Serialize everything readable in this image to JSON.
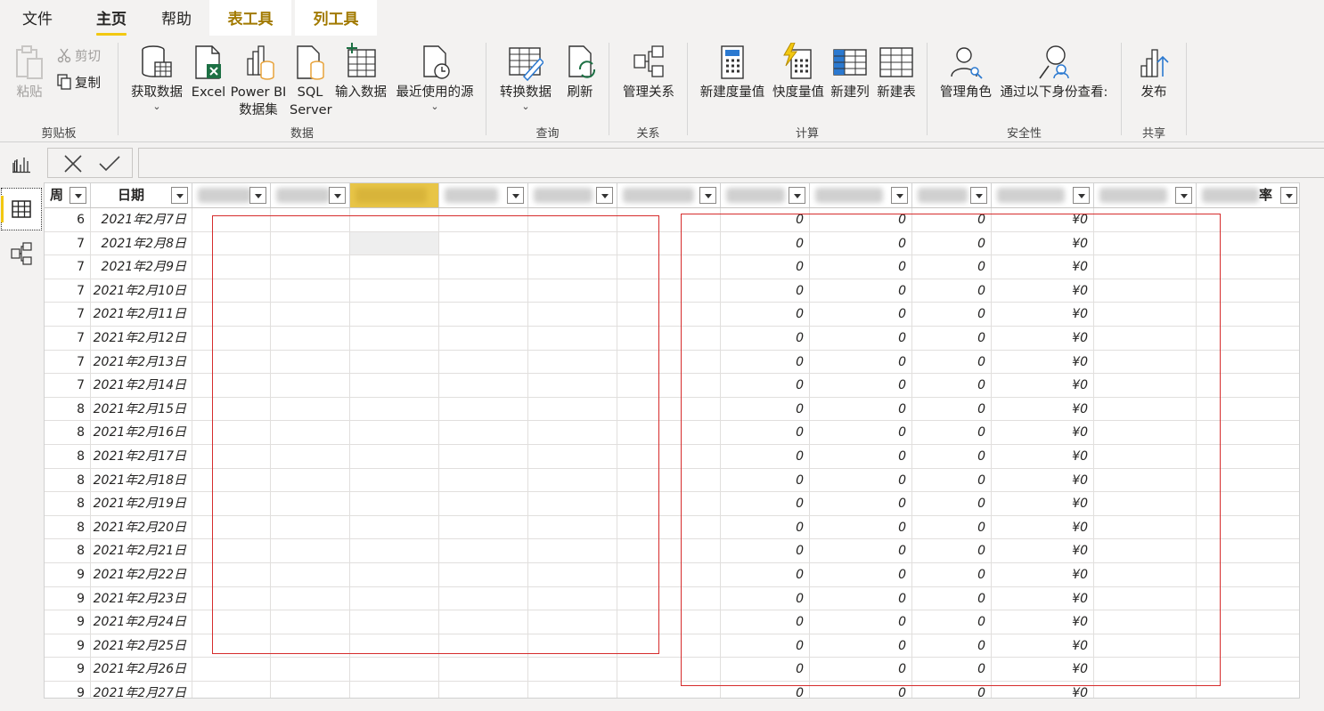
{
  "tabs": {
    "file": "文件",
    "home": "主页",
    "help": "帮助",
    "table_tools": "表工具",
    "column_tools": "列工具"
  },
  "ribbon": {
    "clipboard": {
      "label": "剪贴板",
      "paste": "粘贴",
      "cut": "剪切",
      "copy": "复制"
    },
    "data": {
      "label": "数据",
      "get_data": "获取数据",
      "excel": "Excel",
      "powerbi_line1": "Power BI",
      "powerbi_line2": "数据集",
      "sql_line1": "SQL",
      "sql_line2": "Server",
      "enter_data": "输入数据",
      "recent_sources": "最近使用的源"
    },
    "query": {
      "label": "查询",
      "transform": "转换数据",
      "refresh": "刷新"
    },
    "relationships": {
      "label": "关系",
      "manage": "管理关系"
    },
    "calculations": {
      "label": "计算",
      "new_measure": "新建度量值",
      "quick_measure": "快度量值",
      "new_column": "新建列",
      "new_table": "新建表"
    },
    "security": {
      "label": "安全性",
      "manage_roles": "管理角色",
      "view_as": "通过以下身份查看:"
    },
    "share": {
      "label": "共享",
      "publish": "发布"
    }
  },
  "icons": {
    "report_view": "bar-chart-icon",
    "data_view": "table-grid-icon",
    "model_view": "model-diagram-icon",
    "cancel": "close-x-icon",
    "commit": "checkmark-icon"
  },
  "colors": {
    "accent": "#f2c811",
    "context_tab_text": "#a27a00",
    "highlight_column": "#e8c547",
    "red_box": "#d62c2c"
  },
  "grid": {
    "headers": {
      "week": "周",
      "date": "日期",
      "last": "率"
    },
    "rows": [
      {
        "week": "6",
        "date": "2021年2月7日",
        "v1": "0",
        "v2": "0",
        "v3": "0",
        "amount": "¥0"
      },
      {
        "week": "7",
        "date": "2021年2月8日",
        "v1": "0",
        "v2": "0",
        "v3": "0",
        "amount": "¥0"
      },
      {
        "week": "7",
        "date": "2021年2月9日",
        "v1": "0",
        "v2": "0",
        "v3": "0",
        "amount": "¥0"
      },
      {
        "week": "7",
        "date": "2021年2月10日",
        "v1": "0",
        "v2": "0",
        "v3": "0",
        "amount": "¥0"
      },
      {
        "week": "7",
        "date": "2021年2月11日",
        "v1": "0",
        "v2": "0",
        "v3": "0",
        "amount": "¥0"
      },
      {
        "week": "7",
        "date": "2021年2月12日",
        "v1": "0",
        "v2": "0",
        "v3": "0",
        "amount": "¥0"
      },
      {
        "week": "7",
        "date": "2021年2月13日",
        "v1": "0",
        "v2": "0",
        "v3": "0",
        "amount": "¥0"
      },
      {
        "week": "7",
        "date": "2021年2月14日",
        "v1": "0",
        "v2": "0",
        "v3": "0",
        "amount": "¥0"
      },
      {
        "week": "8",
        "date": "2021年2月15日",
        "v1": "0",
        "v2": "0",
        "v3": "0",
        "amount": "¥0"
      },
      {
        "week": "8",
        "date": "2021年2月16日",
        "v1": "0",
        "v2": "0",
        "v3": "0",
        "amount": "¥0"
      },
      {
        "week": "8",
        "date": "2021年2月17日",
        "v1": "0",
        "v2": "0",
        "v3": "0",
        "amount": "¥0"
      },
      {
        "week": "8",
        "date": "2021年2月18日",
        "v1": "0",
        "v2": "0",
        "v3": "0",
        "amount": "¥0"
      },
      {
        "week": "8",
        "date": "2021年2月19日",
        "v1": "0",
        "v2": "0",
        "v3": "0",
        "amount": "¥0"
      },
      {
        "week": "8",
        "date": "2021年2月20日",
        "v1": "0",
        "v2": "0",
        "v3": "0",
        "amount": "¥0"
      },
      {
        "week": "8",
        "date": "2021年2月21日",
        "v1": "0",
        "v2": "0",
        "v3": "0",
        "amount": "¥0"
      },
      {
        "week": "9",
        "date": "2021年2月22日",
        "v1": "0",
        "v2": "0",
        "v3": "0",
        "amount": "¥0"
      },
      {
        "week": "9",
        "date": "2021年2月23日",
        "v1": "0",
        "v2": "0",
        "v3": "0",
        "amount": "¥0"
      },
      {
        "week": "9",
        "date": "2021年2月24日",
        "v1": "0",
        "v2": "0",
        "v3": "0",
        "amount": "¥0"
      },
      {
        "week": "9",
        "date": "2021年2月25日",
        "v1": "0",
        "v2": "0",
        "v3": "0",
        "amount": "¥0"
      },
      {
        "week": "9",
        "date": "2021年2月26日",
        "v1": "0",
        "v2": "0",
        "v3": "0",
        "amount": "¥0"
      },
      {
        "week": "9",
        "date": "2021年2月27日",
        "v1": "0",
        "v2": "0",
        "v3": "0",
        "amount": "¥0"
      }
    ]
  }
}
